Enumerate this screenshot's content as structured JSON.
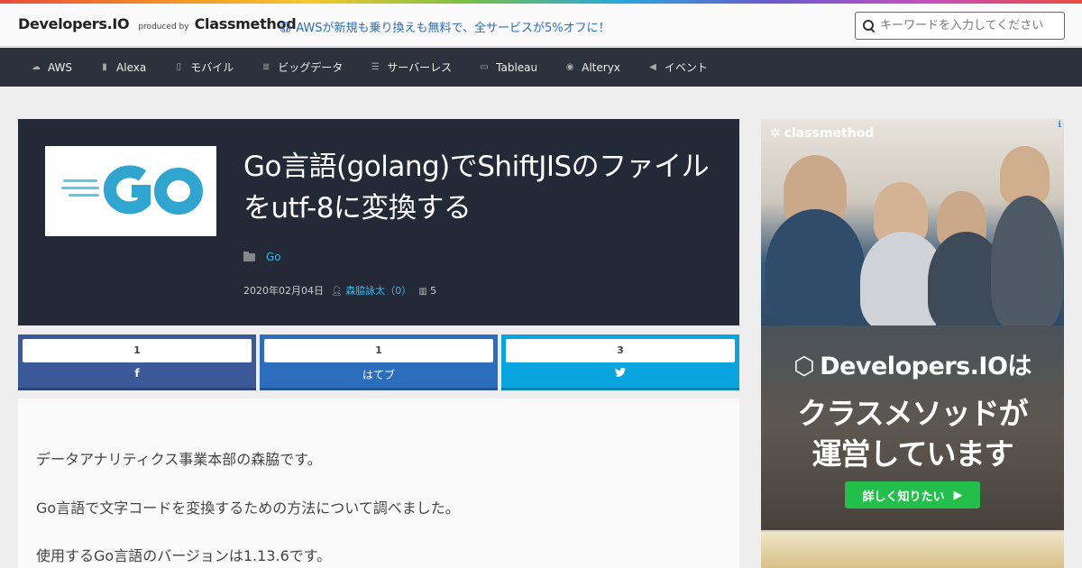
{
  "header": {
    "logo_main": "Developers.IO",
    "logo_produced": "produced by",
    "logo_company": "Classmethod",
    "promo_text": "AWSが新規も乗り換えも無料で、全サービスが5%オフに！",
    "search_placeholder": "キーワードを入力してください"
  },
  "nav": {
    "items": [
      {
        "label": "AWS",
        "icon": "cloud-icon"
      },
      {
        "label": "Alexa",
        "icon": "microphone-icon"
      },
      {
        "label": "モバイル",
        "icon": "mobile-icon"
      },
      {
        "label": "ビッグデータ",
        "icon": "list-icon"
      },
      {
        "label": "サーバーレス",
        "icon": "server-icon"
      },
      {
        "label": "Tableau",
        "icon": "desktop-icon"
      },
      {
        "label": "Alteryx",
        "icon": "circle-icon"
      },
      {
        "label": "イベント",
        "icon": "speaker-icon"
      }
    ]
  },
  "article": {
    "title": "Go言語(golang)でShiftJISのファイルをutf-8に変換する",
    "category": "Go",
    "date": "2020年02月04日",
    "author": "森脇詠太（0）",
    "views": "5",
    "paragraphs": [
      "データアナリティクス事業本部の森脇です。",
      "Go言語で文字コードを変換するための方法について調べました。",
      "使用するGo言語のバージョンは1.13.6です。"
    ]
  },
  "share": {
    "facebook": {
      "count": "1",
      "label": "f"
    },
    "hatena": {
      "count": "1",
      "label": "はてブ"
    },
    "twitter": {
      "count": "3",
      "label": "twitter-bird"
    }
  },
  "ad": {
    "corner_brand": "classmethod",
    "headline_brand": "Developers.IOは",
    "headline_1": "クラスメソッドが",
    "headline_2": "運営しています",
    "cta_label": "詳しく知りたい",
    "cta_arrow": "▶"
  },
  "colors": {
    "nav_bg": "#2b323c",
    "hero_bg": "#232936",
    "link": "#3fb8e8",
    "facebook": "#3b5998",
    "hatena": "#2d6dbd",
    "twitter": "#08a4e0",
    "cta_green": "#22c04a"
  }
}
